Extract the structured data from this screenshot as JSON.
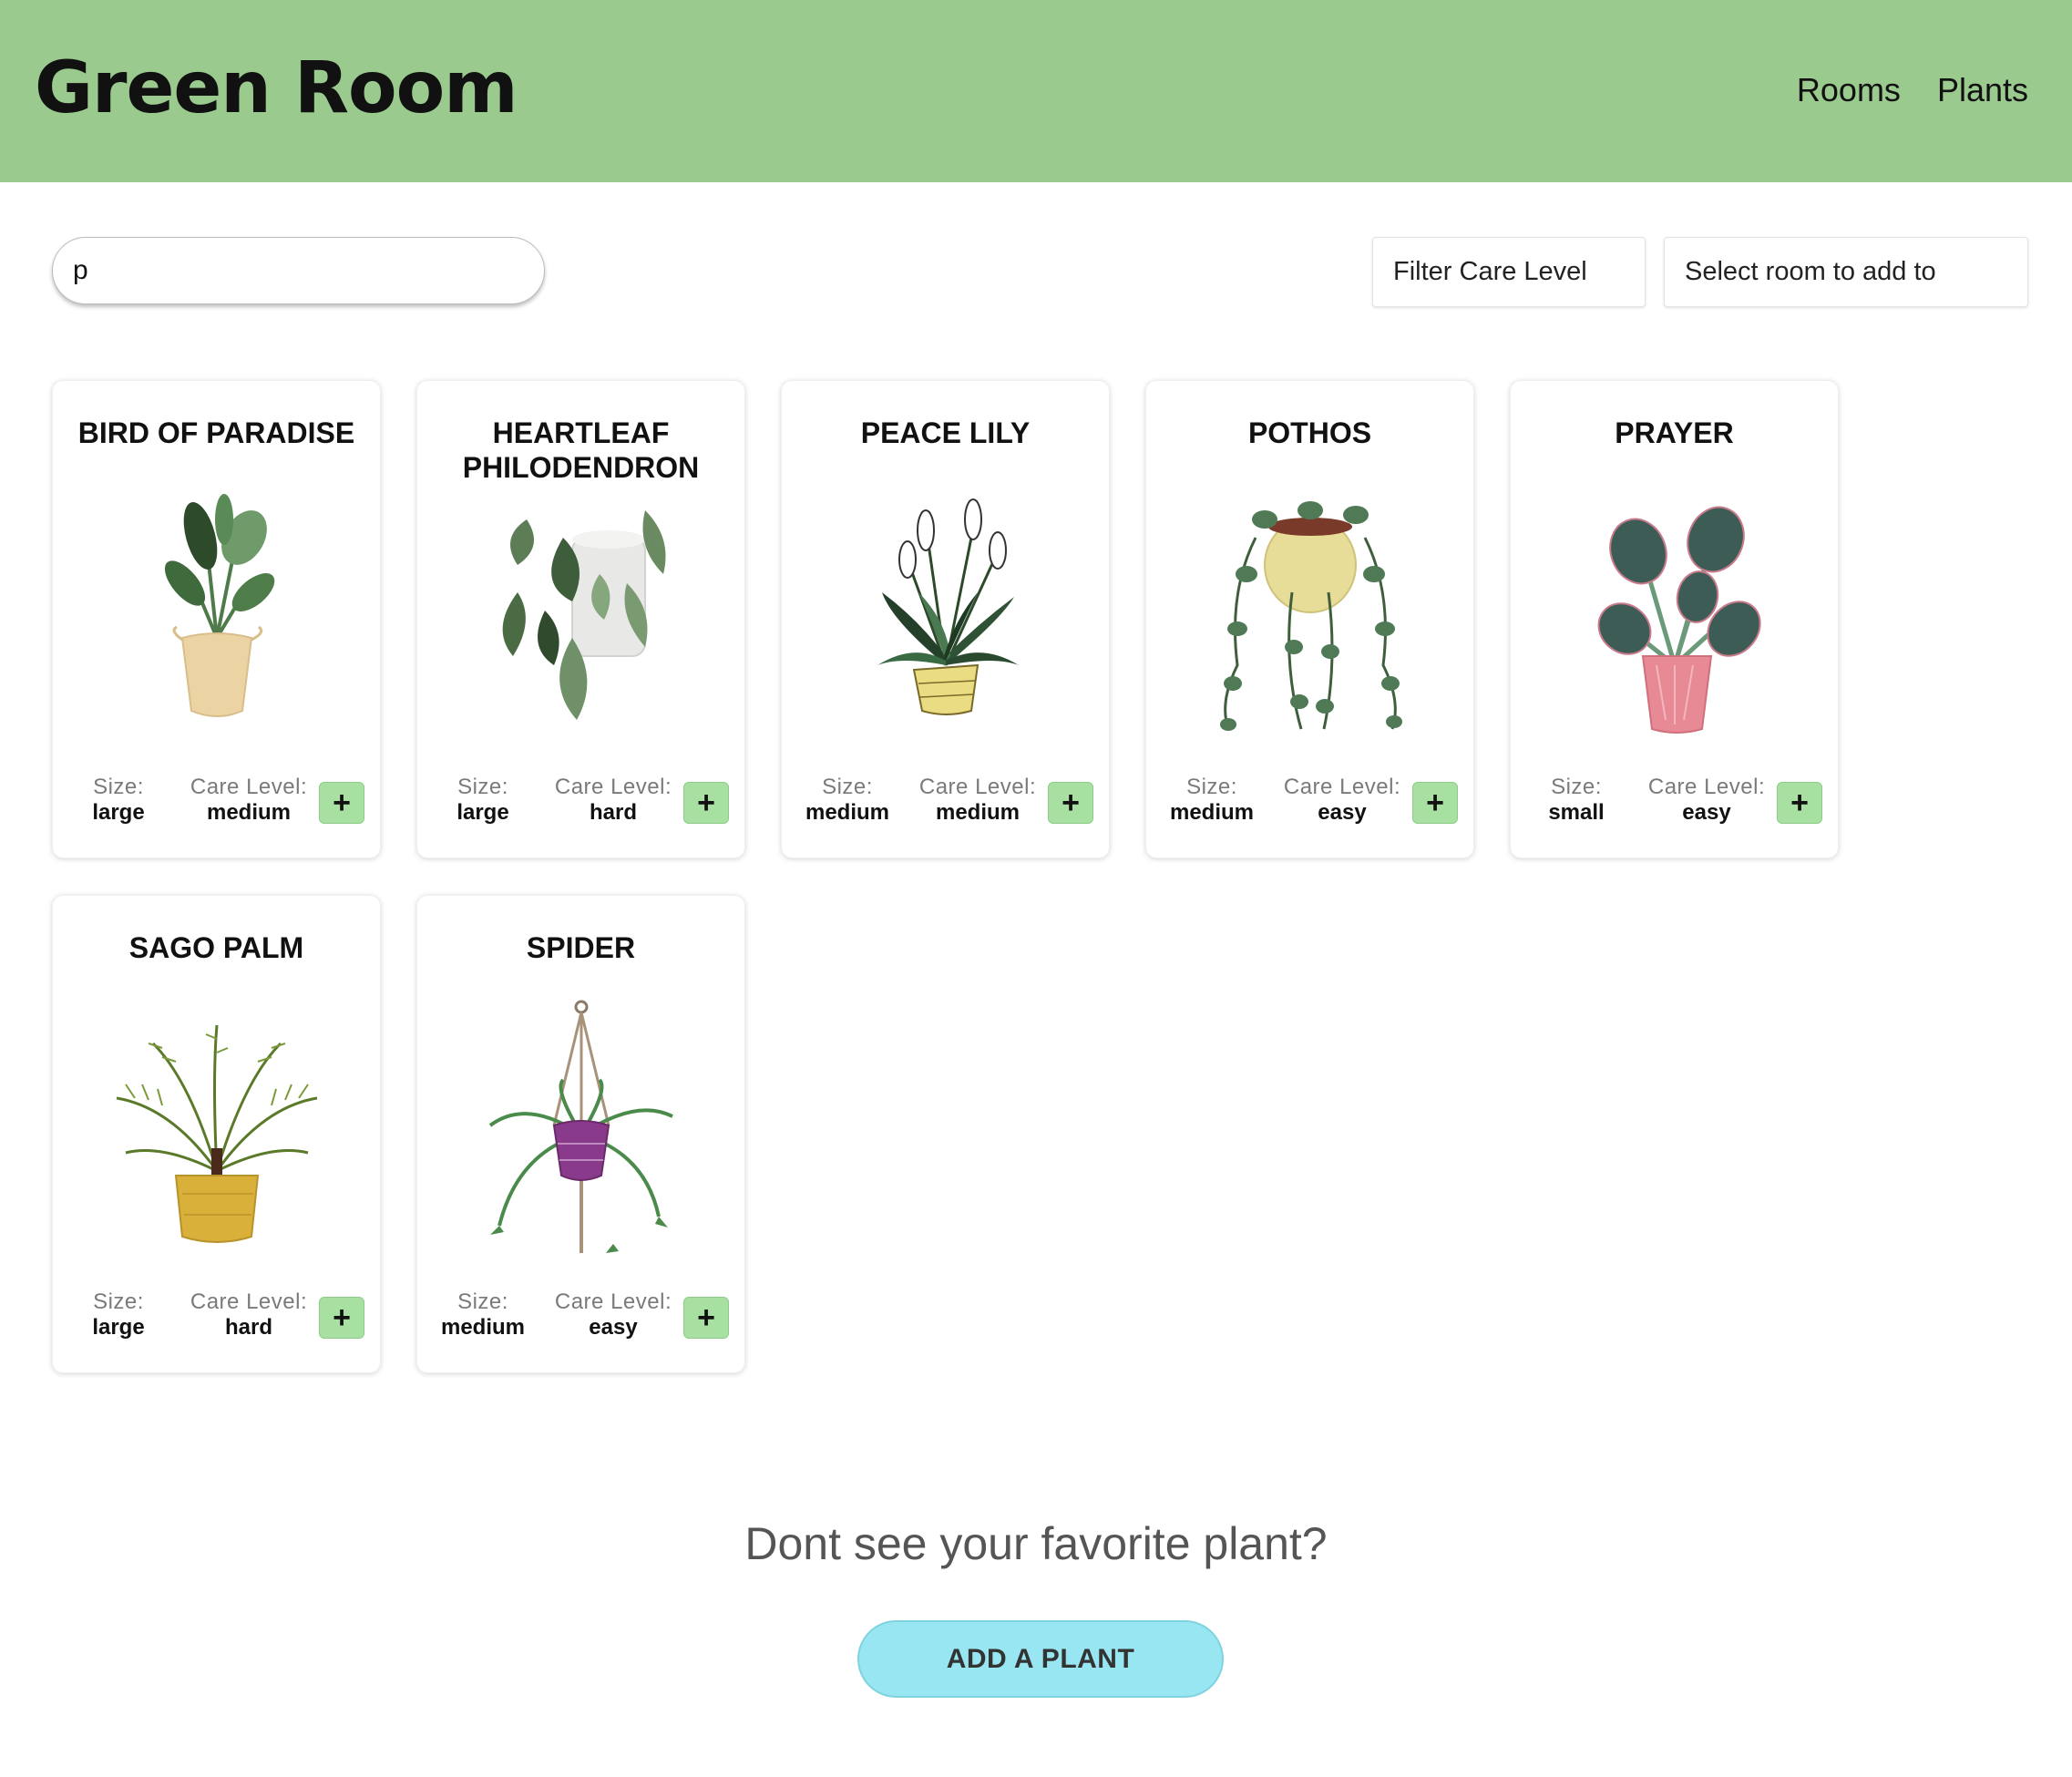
{
  "header": {
    "brand": "Green Room",
    "nav": [
      "Rooms",
      "Plants"
    ]
  },
  "toolbar": {
    "search_value": "p",
    "filter_care_label": "Filter Care Level",
    "select_room_label": "Select room to add to"
  },
  "labels": {
    "size": "Size:",
    "care": "Care Level:",
    "add": "+"
  },
  "plants": [
    {
      "name": "Bird of Paradise",
      "size": "large",
      "care": "medium",
      "icon": "plant-bird-of-paradise-icon"
    },
    {
      "name": "Heartleaf Philodendron",
      "size": "large",
      "care": "hard",
      "icon": "plant-heartleaf-philodendron-icon"
    },
    {
      "name": "Peace Lily",
      "size": "medium",
      "care": "medium",
      "icon": "plant-peace-lily-icon"
    },
    {
      "name": "Pothos",
      "size": "medium",
      "care": "easy",
      "icon": "plant-pothos-icon"
    },
    {
      "name": "Prayer",
      "size": "small",
      "care": "easy",
      "icon": "plant-prayer-icon"
    },
    {
      "name": "Sago Palm",
      "size": "large",
      "care": "hard",
      "icon": "plant-sago-palm-icon"
    },
    {
      "name": "Spider",
      "size": "medium",
      "care": "easy",
      "icon": "plant-spider-icon"
    }
  ],
  "footer": {
    "prompt": "Dont see your favorite plant?",
    "button": "ADD A PLANT"
  },
  "colors": {
    "header_bg": "#9aca8e",
    "add_button": "#a8e0a2",
    "cta_button": "#98e6f1"
  }
}
